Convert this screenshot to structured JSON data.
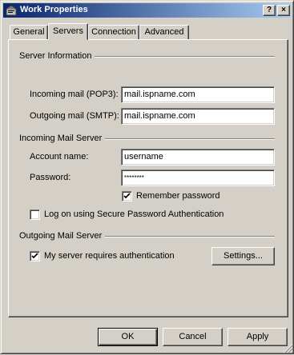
{
  "window": {
    "title": "Work Properties",
    "help_button": "?",
    "close_button": "×"
  },
  "tabs": [
    {
      "label": "General",
      "active": false
    },
    {
      "label": "Servers",
      "active": true
    },
    {
      "label": "Connection",
      "active": false
    },
    {
      "label": "Advanced",
      "active": false
    }
  ],
  "server_info": {
    "heading": "Server Information",
    "incoming_label": "Incoming mail (POP3):",
    "incoming_value": "mail.ispname.com",
    "outgoing_label": "Outgoing mail (SMTP):",
    "outgoing_value": "mail.ispname.com"
  },
  "incoming_server": {
    "heading": "Incoming Mail Server",
    "account_label": "Account name:",
    "account_value": "username",
    "password_label": "Password:",
    "password_value": "********",
    "remember_label": "Remember password",
    "remember_checked": true,
    "spa_label": "Log on using Secure Password Authentication",
    "spa_checked": false
  },
  "outgoing_server": {
    "heading": "Outgoing Mail Server",
    "auth_label": "My server requires authentication",
    "auth_checked": true,
    "settings_button": "Settings..."
  },
  "buttons": {
    "ok": "OK",
    "cancel": "Cancel",
    "apply": "Apply"
  },
  "icons": {
    "title": "mail-properties-icon",
    "checkmark": "checkmark-icon",
    "resize": "size-grip-icon"
  }
}
